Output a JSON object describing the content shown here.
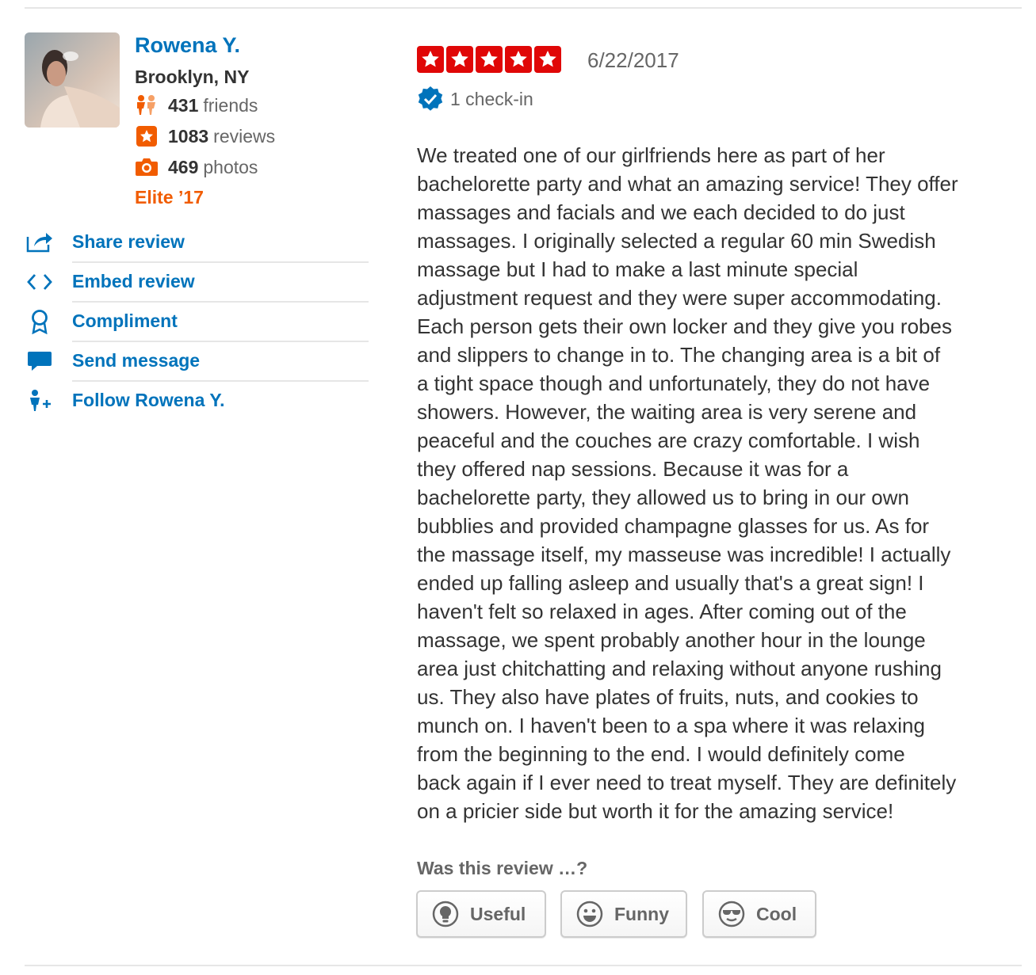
{
  "user": {
    "name": "Rowena Y.",
    "location": "Brooklyn, NY",
    "friends_count": "431",
    "friends_label": "friends",
    "reviews_count": "1083",
    "reviews_label": "reviews",
    "photos_count": "469",
    "photos_label": "photos",
    "elite": "Elite ’17"
  },
  "actions": [
    {
      "label": "Share review",
      "icon": "share-icon"
    },
    {
      "label": "Embed review",
      "icon": "embed-code-icon"
    },
    {
      "label": "Compliment",
      "icon": "compliment-ribbon-icon"
    },
    {
      "label": "Send message",
      "icon": "speech-bubble-icon"
    },
    {
      "label": "Follow Rowena Y.",
      "icon": "follow-user-icon"
    }
  ],
  "review": {
    "rating": 5,
    "max_rating": 5,
    "date": "6/22/2017",
    "checkin": "1 check-in",
    "text": "We treated one of our girlfriends here as part of her\nbachelorette party and what an amazing service! They offer\nmassages and facials and we each decided to do just\nmassages. I originally selected a regular 60 min Swedish\nmassage but I had to make a last minute special\nadjustment request and they were super accommodating.\nEach person gets their own locker and they give you robes\nand slippers to change in to. The changing area is a bit of\na tight space though and unfortunately, they do not have\nshowers.  However, the waiting area is very serene and\npeaceful and the couches are crazy comfortable. I wish\nthey offered nap sessions.  Because it was  for a\nbachelorette party, they allowed us to bring in our own\nbubblies and provided champagne glasses for us. As for\nthe massage itself, my masseuse was incredible!  I actually\nended up falling asleep and  usually that's a great sign! I\nhaven't felt so relaxed in ages. After coming out of the\nmassage, we spent probably another hour in the lounge\narea just chitchatting and relaxing without anyone rushing\nus. They also have plates of fruits, nuts, and cookies to\nmunch on. I haven't been to a spa where it was relaxing\nfrom the beginning to the end. I would definitely come\nback again if I ever need to treat myself. They are definitely\non a pricier side but worth it for the amazing service!"
  },
  "votes": {
    "question": "Was this review …?",
    "useful": "Useful",
    "funny": "Funny",
    "cool": "Cool"
  },
  "colors": {
    "link_blue": "#0073bb",
    "star_red": "#e00707",
    "elite_orange": "#f15c00",
    "stat_orange": "#f15c00",
    "checkin_blue": "#0073bb"
  }
}
